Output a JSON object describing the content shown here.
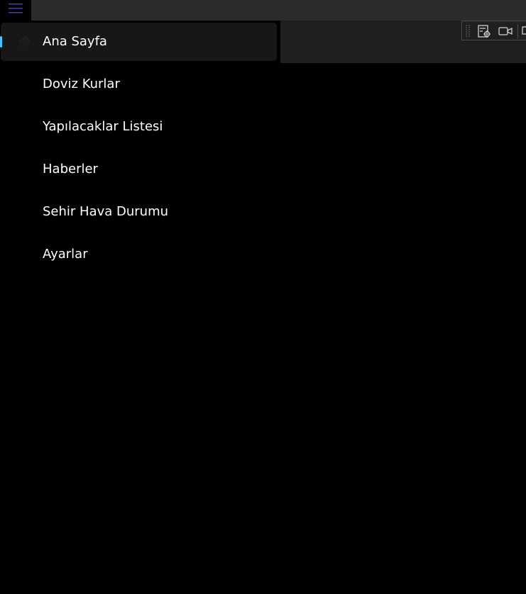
{
  "nav": {
    "items": [
      {
        "label": "Ana Sayfa",
        "icon": "home-icon",
        "selected": true
      },
      {
        "label": "Doviz Kurlar",
        "selected": false
      },
      {
        "label": "Yapılacaklar Listesi",
        "selected": false
      },
      {
        "label": "Haberler",
        "selected": false
      },
      {
        "label": "Sehir Hava Durumu",
        "selected": false
      },
      {
        "label": "Ayarlar",
        "selected": false
      }
    ]
  },
  "colors": {
    "accent": "#4cc2ff",
    "hamburger": "#3b3bff",
    "background": "#000000",
    "titlebar": "#2b2b2b",
    "selected_bg": "#171717"
  },
  "icons": {
    "menu": "hamburger-menu-icon",
    "devbar": [
      "drag-grip-icon",
      "select-element-icon",
      "video-camera-icon",
      "window-icon"
    ]
  }
}
